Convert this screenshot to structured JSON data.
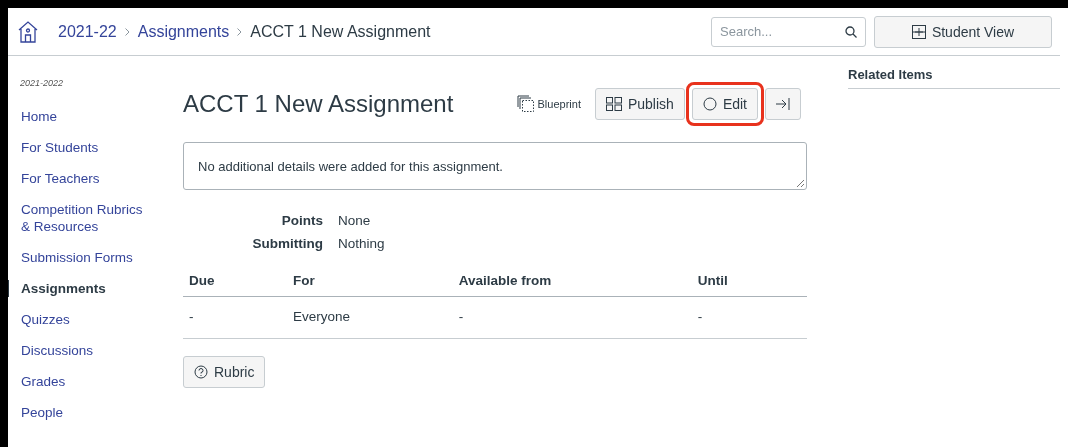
{
  "breadcrumbs": [
    {
      "label": "2021-22",
      "link": true
    },
    {
      "label": "Assignments",
      "link": true
    },
    {
      "label": "ACCT 1 New Assignment",
      "link": false
    }
  ],
  "search": {
    "placeholder": "Search..."
  },
  "student_view_button": "Student View",
  "sidebar": {
    "term": "2021-2022",
    "items": [
      {
        "label": "Home",
        "selected": false
      },
      {
        "label": "For Students",
        "selected": false
      },
      {
        "label": "For Teachers",
        "selected": false
      },
      {
        "label": "Competition Rubrics & Resources",
        "selected": false
      },
      {
        "label": "Submission Forms",
        "selected": false
      },
      {
        "label": "Assignments",
        "selected": true
      },
      {
        "label": "Quizzes",
        "selected": false
      },
      {
        "label": "Discussions",
        "selected": false
      },
      {
        "label": "Grades",
        "selected": false
      },
      {
        "label": "People",
        "selected": false
      }
    ]
  },
  "assignment": {
    "title": "ACCT 1 New Assignment",
    "blueprint": "Blueprint",
    "buttons": [
      {
        "kind": "publish",
        "label": "Publish",
        "highlighted": false
      },
      {
        "kind": "edit",
        "label": "Edit",
        "highlighted": true
      },
      {
        "kind": "collapse",
        "highlighted": false
      }
    ],
    "description": "No additional details were added for this assignment.",
    "details": [
      {
        "label": "Points",
        "value": "None"
      },
      {
        "label": "Submitting",
        "value": "Nothing"
      }
    ],
    "table": {
      "columns": [
        "Due",
        "For",
        "Available from",
        "Until"
      ],
      "rows": [
        [
          "-",
          "Everyone",
          "-",
          "-"
        ]
      ]
    },
    "rubric_button": "Rubric"
  },
  "related": {
    "title": "Related Items"
  }
}
